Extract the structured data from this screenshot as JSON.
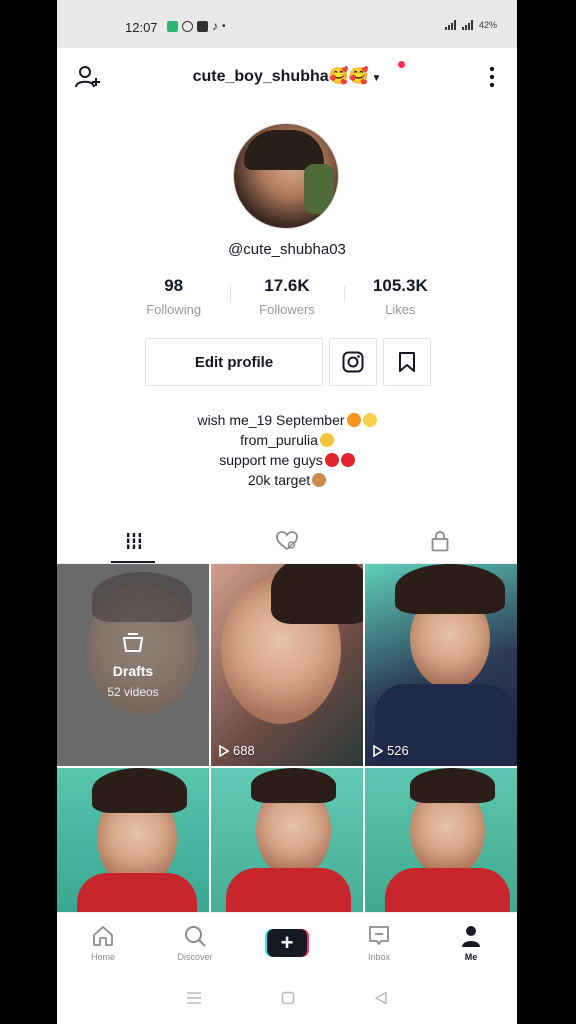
{
  "status_bar": {
    "time": "12:07",
    "battery": "42%"
  },
  "header": {
    "username": "cute_boy_shubha🥰🥰"
  },
  "profile": {
    "handle": "@cute_shubha03"
  },
  "stats": [
    {
      "value": "98",
      "label": "Following"
    },
    {
      "value": "17.6K",
      "label": "Followers"
    },
    {
      "value": "105.3K",
      "label": "Likes"
    }
  ],
  "actions": {
    "edit_label": "Edit profile"
  },
  "bio": {
    "line1": "wish me_19 September",
    "line2": "from_purulia",
    "line3": "support me guys",
    "line4": "20k target"
  },
  "tabs": [
    {
      "icon": "grid-icon"
    },
    {
      "icon": "liked-heart-icon"
    },
    {
      "icon": "lock-icon"
    }
  ],
  "drafts": {
    "title": "Drafts",
    "count": "52 videos"
  },
  "videos": [
    {
      "views": "688"
    },
    {
      "views": "526"
    }
  ],
  "nav": [
    {
      "label": "Home"
    },
    {
      "label": "Discover"
    },
    {
      "label": ""
    },
    {
      "label": "Inbox"
    },
    {
      "label": "Me"
    }
  ],
  "colors": {
    "accent_pink": "#fe2c55",
    "accent_cyan": "#25f4ee",
    "text": "#161823"
  }
}
